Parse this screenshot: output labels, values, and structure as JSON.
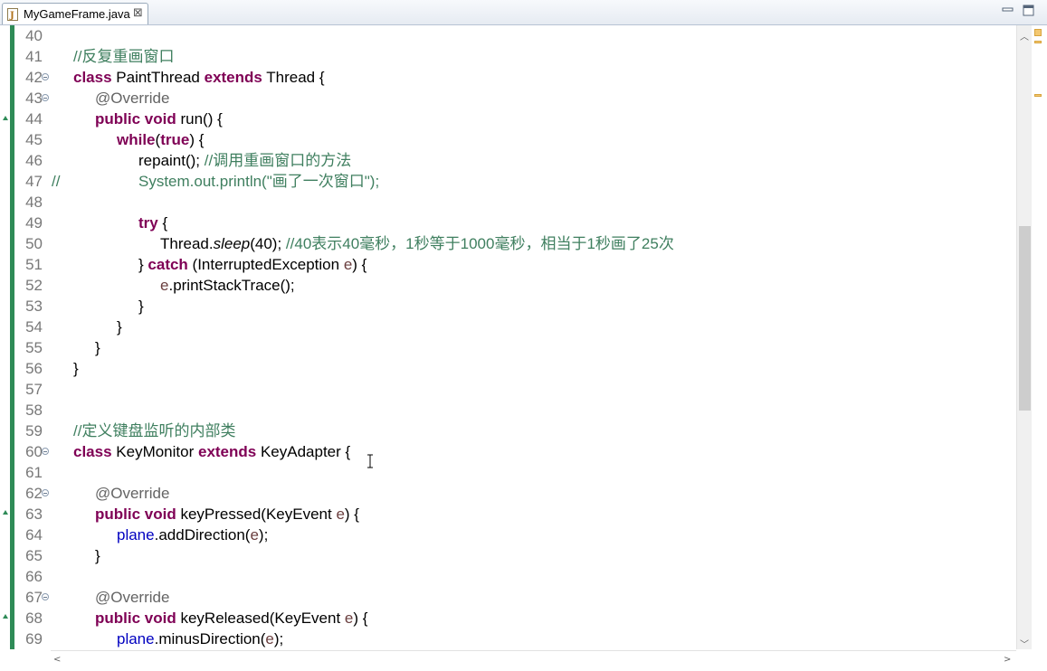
{
  "tab": {
    "title": "MyGameFrame.java",
    "close": "⊠"
  },
  "lines": [
    {
      "num": "40"
    },
    {
      "num": "41",
      "segs": [
        [
          "cm",
          "//反复重画窗口"
        ]
      ],
      "indent": 81
    },
    {
      "num": "42",
      "fold": true,
      "segs": [
        [
          "kw",
          "class"
        ],
        [
          "",
          " PaintThread "
        ],
        [
          "kw",
          "extends"
        ],
        [
          "",
          " Thread {"
        ]
      ],
      "indent": 81
    },
    {
      "num": "43",
      "fold": true,
      "segs": [
        [
          "ann",
          "@Override"
        ]
      ],
      "indent": 105
    },
    {
      "num": "44",
      "segs": [
        [
          "kw",
          "public"
        ],
        [
          "",
          " "
        ],
        [
          "kw",
          "void"
        ],
        [
          "",
          " run() {"
        ]
      ],
      "indent": 105
    },
    {
      "num": "45",
      "segs": [
        [
          "kw",
          "while"
        ],
        [
          "",
          "("
        ],
        [
          "kw",
          "true"
        ],
        [
          "",
          ") {"
        ]
      ],
      "indent": 129
    },
    {
      "num": "46",
      "segs": [
        [
          "",
          "repaint(); "
        ],
        [
          "cm",
          "//调用重画窗口的方法"
        ]
      ],
      "indent": 153
    },
    {
      "num": "47",
      "lineComment": "//",
      "segs": [
        [
          "cm",
          "System.out.println(\"画了一次窗口\");"
        ]
      ],
      "indent": 153
    },
    {
      "num": "48"
    },
    {
      "num": "49",
      "segs": [
        [
          "kw",
          "try"
        ],
        [
          "",
          " {"
        ]
      ],
      "indent": 153
    },
    {
      "num": "50",
      "segs": [
        [
          "",
          "Thread."
        ],
        [
          "it",
          "sleep"
        ],
        [
          "",
          "(40); "
        ],
        [
          "cm",
          "//40表示40毫秒，1秒等于1000毫秒，相当于1秒画了25次"
        ]
      ],
      "indent": 177
    },
    {
      "num": "51",
      "segs": [
        [
          "",
          "} "
        ],
        [
          "kw",
          "catch"
        ],
        [
          "",
          " (InterruptedException "
        ],
        [
          "var",
          "e"
        ],
        [
          "",
          ") {"
        ]
      ],
      "indent": 153
    },
    {
      "num": "52",
      "segs": [
        [
          "var",
          "e"
        ],
        [
          "",
          ".printStackTrace();"
        ]
      ],
      "indent": 177
    },
    {
      "num": "53",
      "segs": [
        [
          "",
          "}"
        ]
      ],
      "indent": 153
    },
    {
      "num": "54",
      "segs": [
        [
          "",
          "}"
        ]
      ],
      "indent": 129
    },
    {
      "num": "55",
      "segs": [
        [
          "",
          "}"
        ]
      ],
      "indent": 105
    },
    {
      "num": "56",
      "segs": [
        [
          "",
          "}"
        ]
      ],
      "indent": 81
    },
    {
      "num": "57"
    },
    {
      "num": "58"
    },
    {
      "num": "59",
      "segs": [
        [
          "cm",
          "//定义键盘监听的内部类"
        ]
      ],
      "indent": 81
    },
    {
      "num": "60",
      "fold": true,
      "segs": [
        [
          "kw",
          "class"
        ],
        [
          "",
          " KeyMonitor "
        ],
        [
          "kw",
          "extends"
        ],
        [
          "",
          " KeyAdapter {"
        ]
      ],
      "indent": 81
    },
    {
      "num": "61"
    },
    {
      "num": "62",
      "fold": true,
      "segs": [
        [
          "ann",
          "@Override"
        ]
      ],
      "indent": 105
    },
    {
      "num": "63",
      "segs": [
        [
          "kw",
          "public"
        ],
        [
          "",
          " "
        ],
        [
          "kw",
          "void"
        ],
        [
          "",
          " keyPressed(KeyEvent "
        ],
        [
          "var",
          "e"
        ],
        [
          "",
          ") {"
        ]
      ],
      "indent": 105
    },
    {
      "num": "64",
      "segs": [
        [
          "fld",
          "plane"
        ],
        [
          "",
          ".addDirection("
        ],
        [
          "var",
          "e"
        ],
        [
          "",
          ");"
        ]
      ],
      "indent": 129
    },
    {
      "num": "65",
      "segs": [
        [
          "",
          "}"
        ]
      ],
      "indent": 105
    },
    {
      "num": "66"
    },
    {
      "num": "67",
      "fold": true,
      "segs": [
        [
          "ann",
          "@Override"
        ]
      ],
      "indent": 105
    },
    {
      "num": "68",
      "segs": [
        [
          "kw",
          "public"
        ],
        [
          "",
          " "
        ],
        [
          "kw",
          "void"
        ],
        [
          "",
          " keyReleased(KeyEvent "
        ],
        [
          "var",
          "e"
        ],
        [
          "",
          ") {"
        ]
      ],
      "indent": 105
    },
    {
      "num": "69",
      "segs": [
        [
          "fld",
          "plane"
        ],
        [
          "",
          ".minusDirection("
        ],
        [
          "var",
          "e"
        ],
        [
          "",
          ");"
        ]
      ],
      "indent": 129
    }
  ],
  "colors": {
    "keyword": "#7f0055",
    "comment": "#3f7f5f",
    "annotation": "#646464",
    "field": "#0000c0",
    "local": "#6a3e3e",
    "lineNumber": "#787878",
    "gutterStrip": "#2e8b57"
  }
}
